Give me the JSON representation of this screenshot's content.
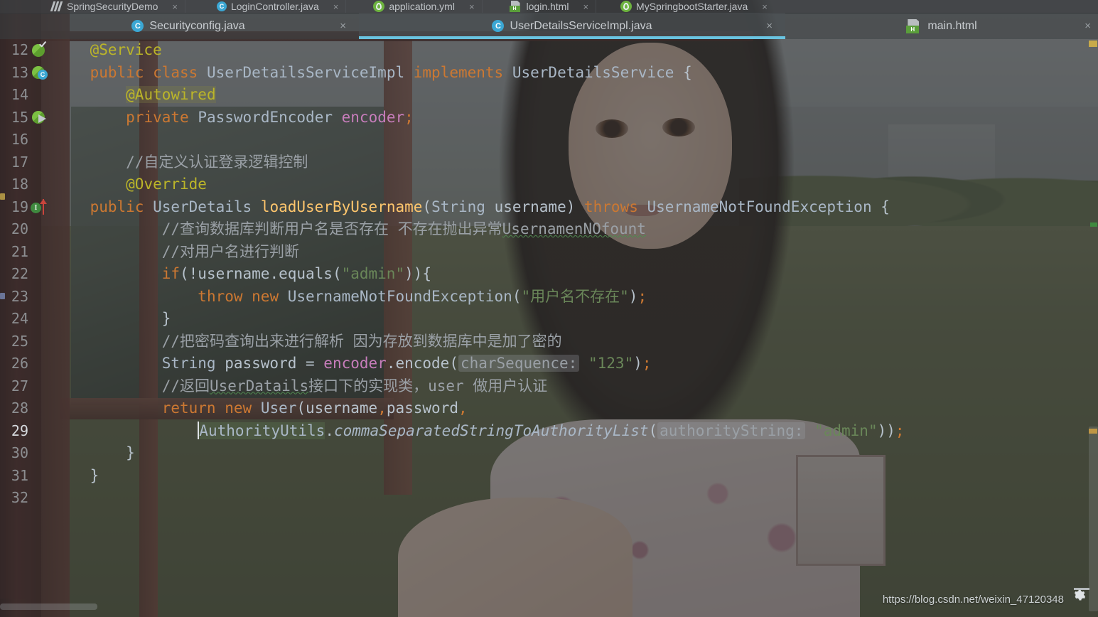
{
  "window": {
    "top_tabs": [
      {
        "label": "SpringSecurityDemo",
        "icon": "spring-module-icon",
        "close": "×"
      },
      {
        "label": "LoginController.java",
        "icon": "java-class-icon",
        "close": "×"
      },
      {
        "label": "application.yml",
        "icon": "yaml-icon",
        "close": "×"
      },
      {
        "label": "login.html",
        "icon": "html-file-icon",
        "close": "×"
      },
      {
        "label": "MySpringbootStarter.java",
        "icon": "java-class-icon",
        "close": "×"
      }
    ],
    "editor_tabs": [
      {
        "label": "Securityconfig.java",
        "icon": "java-class-icon",
        "close": "×",
        "selected": false
      },
      {
        "label": "UserDetailsServiceImpl.java",
        "icon": "java-class-icon",
        "close": "×",
        "selected": true
      },
      {
        "label": "main.html",
        "icon": "html-file-icon",
        "close": "×",
        "selected": false
      }
    ]
  },
  "colors": {
    "accent_tab_underline": "#69c3e0",
    "keyword": "#cc7832",
    "annotation": "#bbb529",
    "string": "#6a8759",
    "method": "#ffc66d",
    "field": "#c77dbb",
    "identifier": "#a9b7c6",
    "comment": "#9aa0a6",
    "number": "#6897bb",
    "marker_warning": "#c8aa4a",
    "marker_ok": "#3f8a3f",
    "marker_error": "#c9453c"
  },
  "code": {
    "first_line": 12,
    "lines": [
      {
        "n": 12,
        "gutter": "spring-bean-check-icon",
        "text": "    @Service"
      },
      {
        "n": 13,
        "gutter": "spring-bean-class-icon",
        "text": "    public class UserDetailsServiceImpl implements UserDetailsService {"
      },
      {
        "n": 14,
        "gutter": "",
        "text": "        @Autowired"
      },
      {
        "n": 15,
        "gutter": "spring-bean-arrow-icon",
        "text": "        private PasswordEncoder encoder;"
      },
      {
        "n": 16,
        "gutter": "",
        "text": ""
      },
      {
        "n": 17,
        "gutter": "",
        "text": "        //自定义认证登录逻辑控制"
      },
      {
        "n": 18,
        "gutter": "",
        "text": "        @Override"
      },
      {
        "n": 19,
        "gutter": "implemented-method-icon",
        "text": "        public UserDetails loadUserByUsername(String username) throws UsernameNotFoundException {"
      },
      {
        "n": 20,
        "gutter": "",
        "text": "            //查询数据库判断用户名是否存在 不存在抛出异常UsernamenNOfount"
      },
      {
        "n": 21,
        "gutter": "",
        "text": "            //对用户名进行判断"
      },
      {
        "n": 22,
        "gutter": "",
        "text": "            if(!username.equals(\"admin\")){"
      },
      {
        "n": 23,
        "gutter": "",
        "text": "                throw new UsernameNotFoundException(\"用户名不存在\");"
      },
      {
        "n": 24,
        "gutter": "",
        "text": "            }"
      },
      {
        "n": 25,
        "gutter": "",
        "text": "            //把密码查询出来进行解析 因为存放到数据库中是加了密的"
      },
      {
        "n": 26,
        "gutter": "",
        "text": "            String password = encoder.encode( charSequence: \"123\");"
      },
      {
        "n": 27,
        "gutter": "",
        "text": "            //返回UserDatails接口下的实现类，user 做用户认证"
      },
      {
        "n": 28,
        "gutter": "",
        "text": "            return new User(username,password,"
      },
      {
        "n": 29,
        "gutter": "",
        "text": "                AuthorityUtils.commaSeparatedStringToAuthorityList( authorityString: \"admin\"));"
      },
      {
        "n": 30,
        "gutter": "",
        "text": "        }"
      },
      {
        "n": 31,
        "gutter": "",
        "text": "    }"
      },
      {
        "n": 32,
        "gutter": "",
        "text": ""
      }
    ],
    "inlay_hints": [
      "charSequence:",
      "authorityString:"
    ],
    "caret_line": 29,
    "caret_column": 17
  },
  "status": {
    "watermark": "https://blog.csdn.net/weixin_47120348",
    "gear_icon": "settings-gear-icon",
    "minimize_icon": "minimize-icon"
  }
}
